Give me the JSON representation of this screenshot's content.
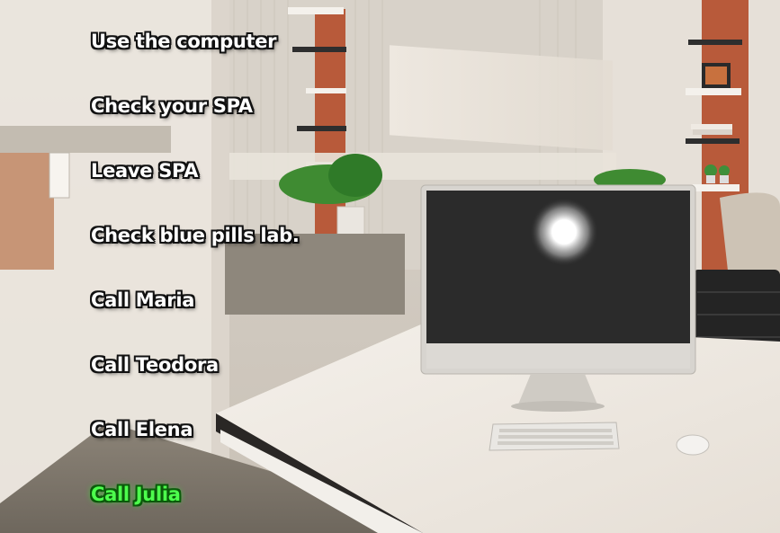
{
  "menu": {
    "choices": [
      {
        "label": "Use the computer"
      },
      {
        "label": "Check your SPA"
      },
      {
        "label": "Leave SPA"
      },
      {
        "label": "Check blue pills lab."
      },
      {
        "label": "Call Maria"
      },
      {
        "label": "Call Teodora"
      },
      {
        "label": "Call Elena"
      },
      {
        "label": "Call Julia"
      }
    ],
    "selected_index": 7,
    "selected_color": "#4dff4d",
    "text_color": "#ffffff"
  },
  "scene": {
    "objects": [
      "office-room",
      "frosted-glass-partition",
      "wall-shelves",
      "potted-plants",
      "desk",
      "desktop-computer-monitor",
      "keyboard",
      "mouse",
      "office-chair",
      "armchair"
    ]
  }
}
